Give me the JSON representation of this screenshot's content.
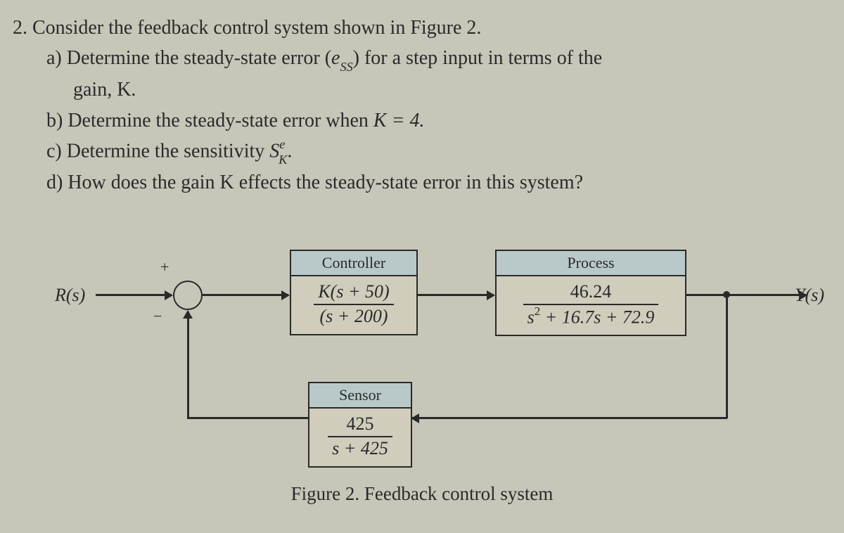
{
  "problem": {
    "number": "2.",
    "intro": "Consider the feedback control system shown in Figure 2.",
    "parts": {
      "a": {
        "label": "a)",
        "text_before": "Determine the steady-state error (",
        "ess_var": "e",
        "ess_sub": "SS",
        "text_after": ") for a step input in terms of the"
      },
      "a_cont": "gain, K.",
      "b": {
        "label": "b)",
        "text": "Determine the steady-state error when ",
        "kval": "K = 4."
      },
      "c": {
        "label": "c)",
        "text": "Determine the sensitivity ",
        "svar": "S",
        "s_sub": "K",
        "s_sup": "e",
        "period": "."
      },
      "d": {
        "label": "d)",
        "text": "How does the gain K effects the steady-state error in this system?"
      }
    }
  },
  "diagram": {
    "input_label": "R(s)",
    "output_label": "Y(s)",
    "plus": "+",
    "minus": "−",
    "controller": {
      "title": "Controller",
      "num": "K(s + 50)",
      "den": "(s + 200)"
    },
    "process": {
      "title": "Process",
      "num": "46.24",
      "den_s2": "s",
      "den_rest": " + 16.7s + 72.9"
    },
    "sensor": {
      "title": "Sensor",
      "num": "425",
      "den": "s + 425"
    },
    "caption": "Figure 2. Feedback control system"
  }
}
